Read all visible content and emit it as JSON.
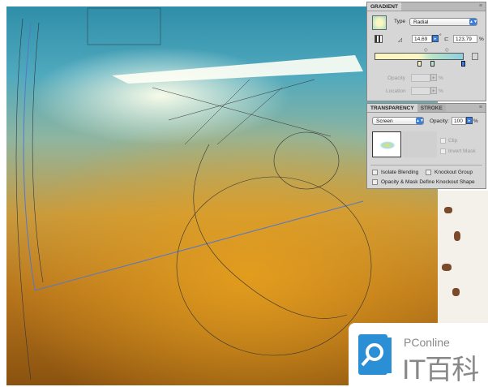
{
  "gradient_panel": {
    "tab_label": "GRADIENT",
    "type_label": "Type",
    "type_value": "Radial",
    "angle_value": "14,69",
    "aspect_value": "123,79",
    "aspect_unit": "%",
    "angle_unit": "°",
    "opacity_label": "Opacity",
    "location_label": "Location",
    "percent": "%",
    "colors": {
      "start": "#fdf6c0",
      "mid": "#b8e4c8",
      "end": "#8ccfe0"
    }
  },
  "transparency_panel": {
    "tab_label": "TRANSPARENCY",
    "stroke_tab_label": "STROKE",
    "blend_mode": "Screen",
    "opacity_label": "Opacity:",
    "opacity_value": "100",
    "percent": "%",
    "clip_label": "Clip",
    "invert_mask_label": "Invert Mask",
    "isolate_blending_label": "Isolate Blending",
    "knockout_group_label": "Knockout Group",
    "opacity_mask_label": "Opacity & Mask Define Knockout Shape"
  },
  "watermark": {
    "brand": "PConline",
    "name": "IT百科",
    "color": "#2b8fd6"
  }
}
